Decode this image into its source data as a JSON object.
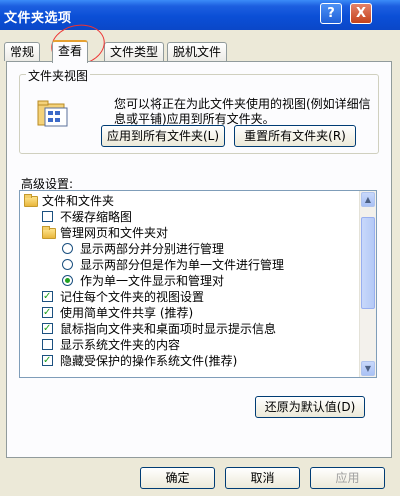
{
  "window": {
    "title": "文件夹选项",
    "help_glyph": "?",
    "close_glyph": "X"
  },
  "tabs": [
    {
      "label": "常规"
    },
    {
      "label": "查看"
    },
    {
      "label": "文件类型"
    },
    {
      "label": "脱机文件"
    }
  ],
  "folder_view": {
    "group_title": "文件夹视图",
    "description": "您可以将正在为此文件夹使用的视图(例如详细信息或平铺)应用到所有文件夹。",
    "apply_all_button": "应用到所有文件夹(L)",
    "reset_all_button": "重置所有文件夹(R)"
  },
  "advanced": {
    "label": "高级设置:",
    "items": [
      {
        "type": "folder",
        "label": "文件和文件夹",
        "level": 0
      },
      {
        "type": "checkbox",
        "label": "不缓存缩略图",
        "checked": false,
        "level": 1
      },
      {
        "type": "folder",
        "label": "管理网页和文件夹对",
        "level": 1
      },
      {
        "type": "radio",
        "label": "显示两部分并分别进行管理",
        "checked": false,
        "level": 2
      },
      {
        "type": "radio",
        "label": "显示两部分但是作为单一文件进行管理",
        "checked": false,
        "level": 2
      },
      {
        "type": "radio",
        "label": "作为单一文件显示和管理对",
        "checked": true,
        "level": 2
      },
      {
        "type": "checkbox",
        "label": "记住每个文件夹的视图设置",
        "checked": true,
        "level": 1
      },
      {
        "type": "checkbox",
        "label": "使用简单文件共享 (推荐)",
        "checked": true,
        "level": 1
      },
      {
        "type": "checkbox",
        "label": "鼠标指向文件夹和桌面项时显示提示信息",
        "checked": true,
        "level": 1
      },
      {
        "type": "checkbox",
        "label": "显示系统文件夹的内容",
        "checked": false,
        "level": 1
      },
      {
        "type": "checkbox",
        "label": "隐藏受保护的操作系统文件(推荐)",
        "checked": true,
        "level": 1
      }
    ],
    "restore_button": "还原为默认值(D)"
  },
  "footer": {
    "ok_button": "确定",
    "cancel_button": "取消",
    "apply_button": "应用"
  },
  "colors": {
    "title_bar": "#0b4fd6",
    "dialog_bg": "#ece9d8",
    "annotation_circle": "#ee3333",
    "check_mark": "#21a121"
  }
}
